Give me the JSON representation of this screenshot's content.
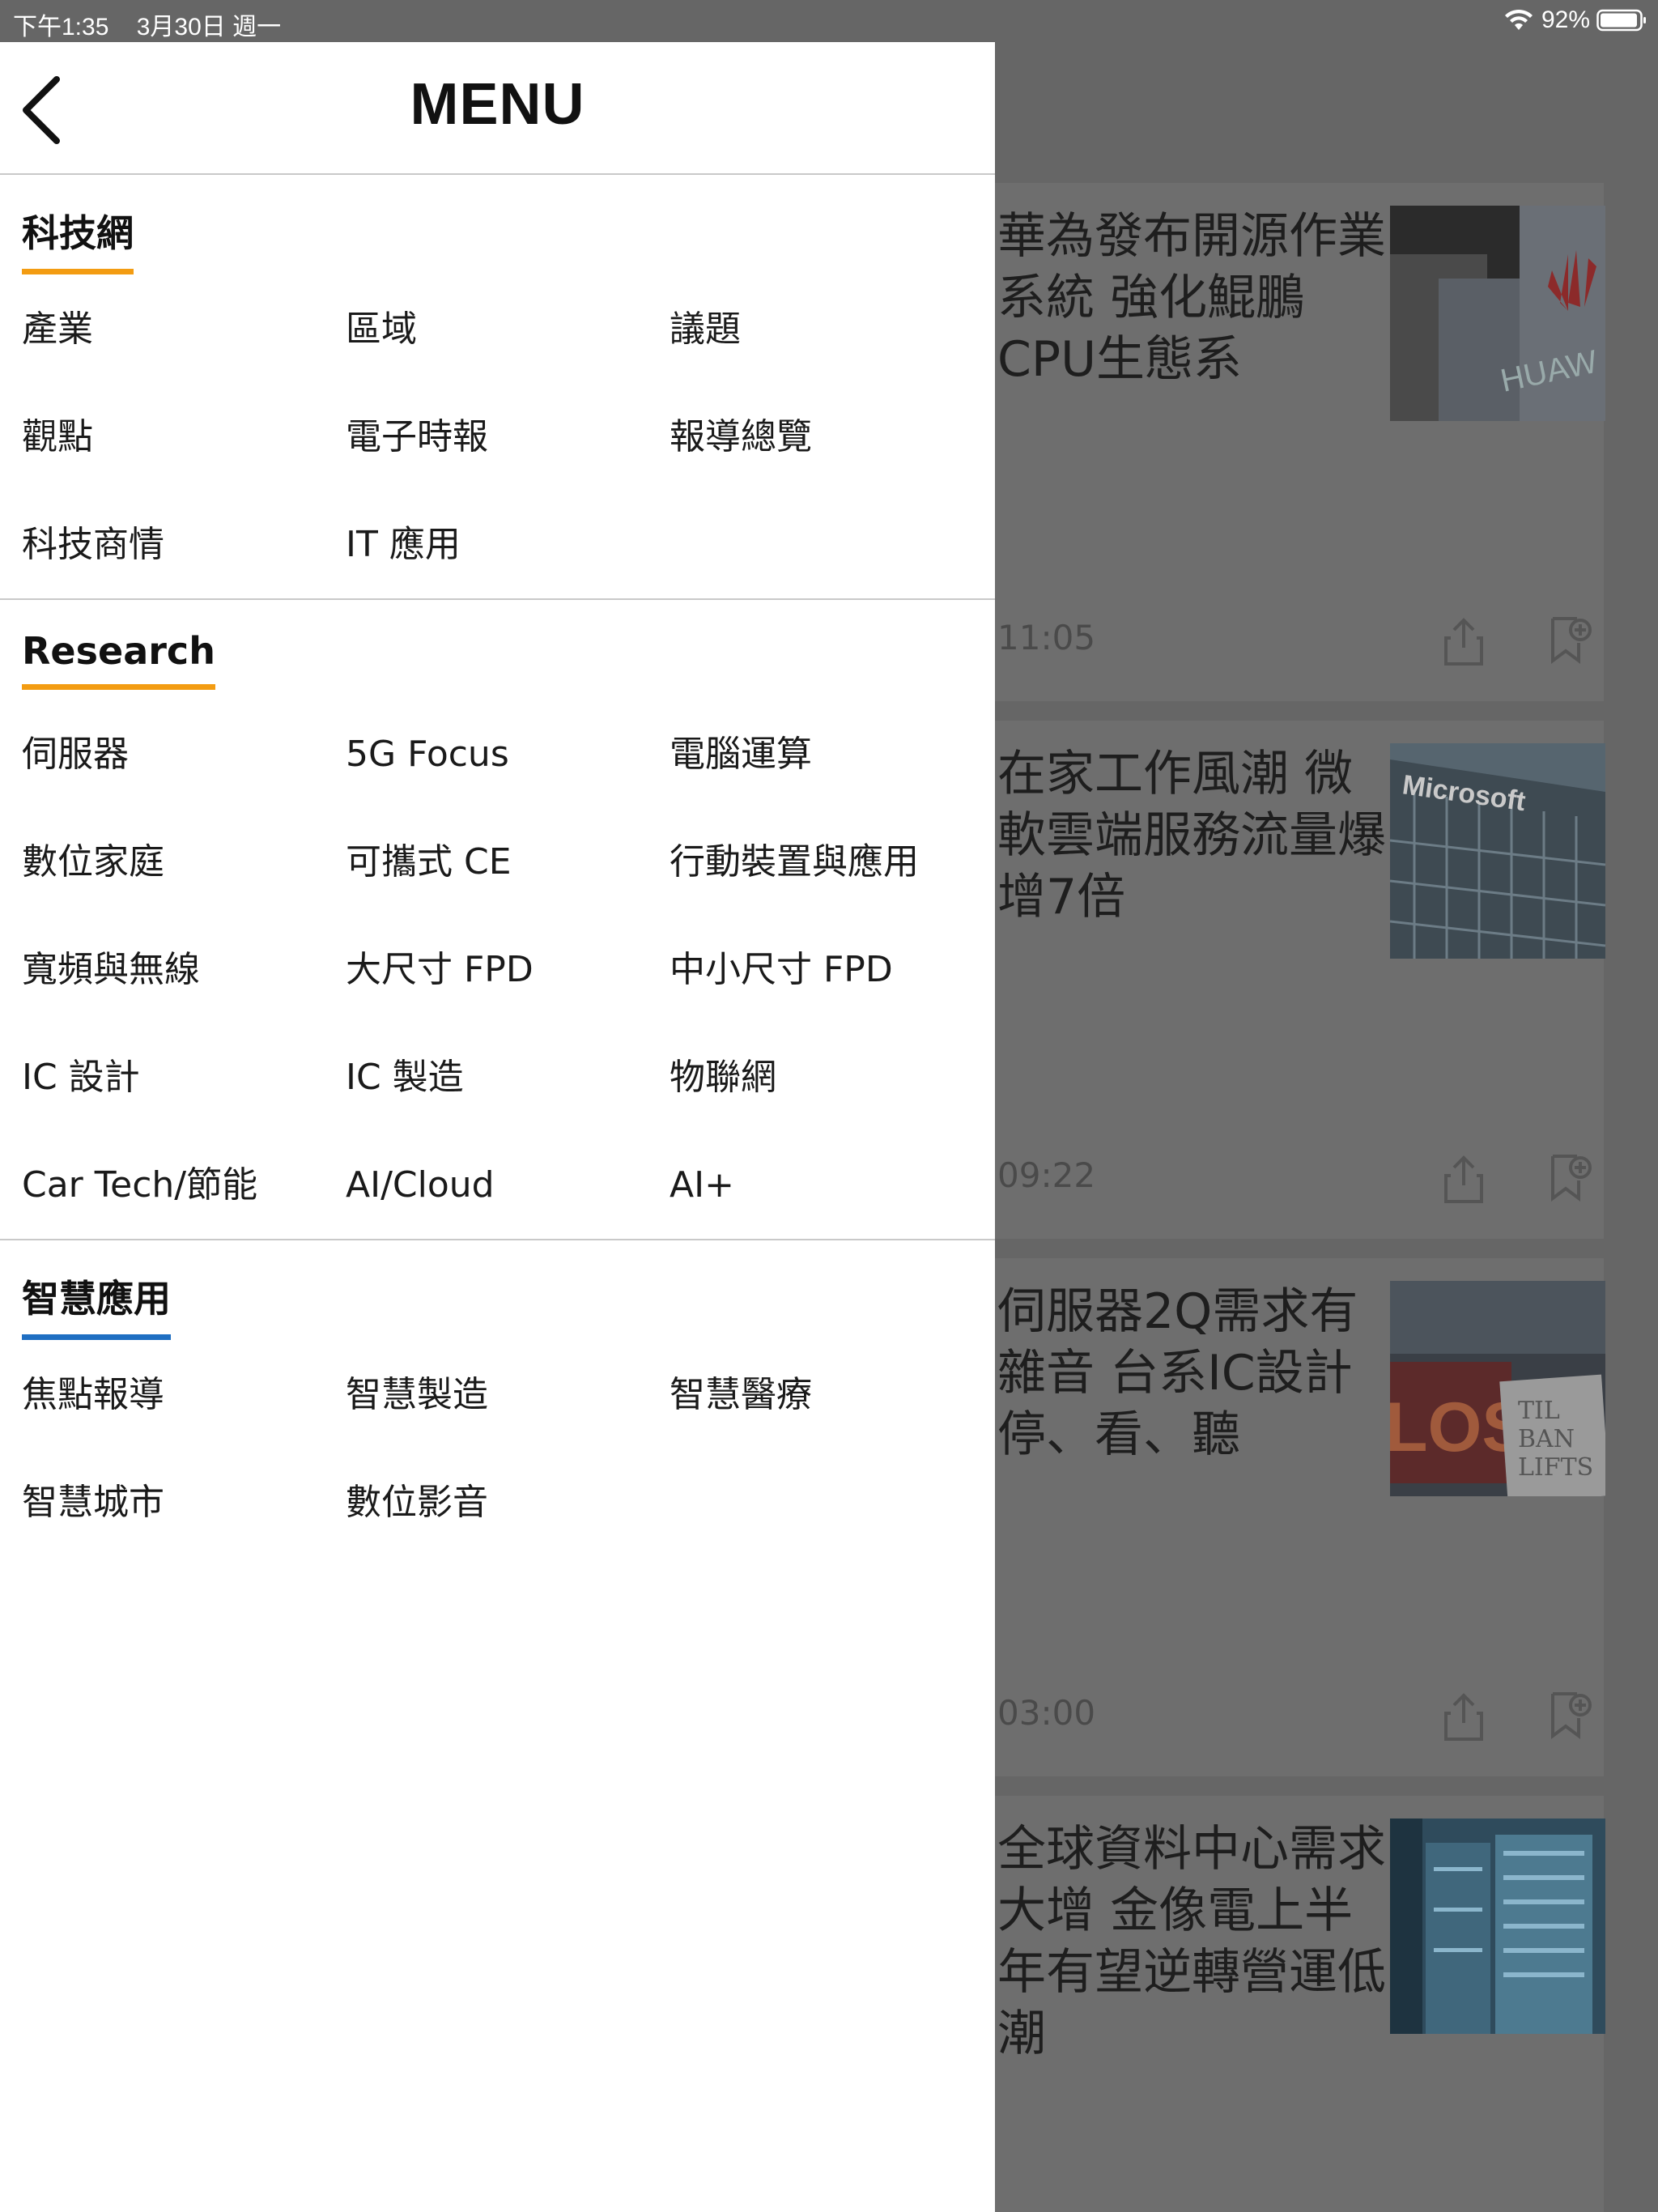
{
  "status_bar": {
    "time": "下午1:35",
    "date": "3月30日 週一",
    "battery": "92%",
    "icons": [
      "wifi-icon",
      "battery-icon"
    ]
  },
  "menu": {
    "title": "MENU",
    "sections": [
      {
        "title": "科技網",
        "accent": "#f39c12",
        "items": [
          "產業",
          "區域",
          "議題",
          "觀點",
          "電子時報",
          "報導總覽",
          "科技商情",
          "IT 應用"
        ]
      },
      {
        "title": "Research",
        "accent": "#f39c12",
        "items": [
          "伺服器",
          "5G Focus",
          "電腦運算",
          "數位家庭",
          "可攜式 CE",
          "行動裝置與應用",
          "寬頻與無線",
          "大尺寸 FPD",
          "中小尺寸 FPD",
          "IC 設計",
          "IC 製造",
          "物聯網",
          "Car Tech/節能",
          "AI/Cloud",
          "AI+"
        ]
      },
      {
        "title": "智慧應用",
        "accent": "#1f6fc2",
        "items": [
          "焦點報導",
          "智慧製造",
          "智慧醫療",
          "智慧城市",
          "數位影音"
        ]
      }
    ]
  },
  "articles": [
    {
      "title": "華為發布開源作業系統 強化鯤鵬CPU生態系",
      "time": "11:05",
      "thumb": "huawei-building-image"
    },
    {
      "title": "在家工作風潮 微軟雲端服務流量爆增7倍",
      "time": "09:22",
      "thumb": "microsoft-building-image"
    },
    {
      "title": "伺服器2Q需求有雜音 台系IC設計停、看、聽",
      "time": "03:00",
      "thumb": "closed-sign-image"
    },
    {
      "title": "全球資料中心需求大增 金像電上半年有望逆轉營運低潮",
      "time": "",
      "thumb": "datacenter-image"
    }
  ]
}
